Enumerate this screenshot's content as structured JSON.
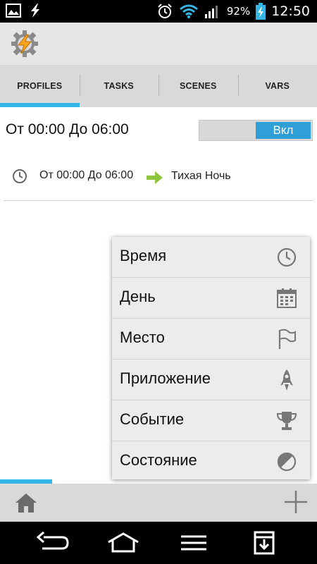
{
  "status_bar": {
    "battery_percent": "92%",
    "time": "12:50"
  },
  "tabs": [
    {
      "label": "PROFILES",
      "active": true
    },
    {
      "label": "TASKS",
      "active": false
    },
    {
      "label": "SCENES",
      "active": false
    },
    {
      "label": "VARS",
      "active": false
    }
  ],
  "profile": {
    "title": "От 00:00 До 06:00",
    "toggle_label": "Вкл",
    "context": "От 00:00 До 06:00",
    "task": "Тихая Ночь"
  },
  "menu": {
    "items": [
      {
        "label": "Время",
        "icon": "clock-icon"
      },
      {
        "label": "День",
        "icon": "calendar-icon"
      },
      {
        "label": "Место",
        "icon": "flag-icon"
      },
      {
        "label": "Приложение",
        "icon": "rocket-icon"
      },
      {
        "label": "Событие",
        "icon": "trophy-icon"
      },
      {
        "label": "Состояние",
        "icon": "half-circle-icon"
      }
    ]
  },
  "colors": {
    "accent": "#33b5e5",
    "toggle_on": "#2f9fd8",
    "arrow": "#8dc63f"
  }
}
